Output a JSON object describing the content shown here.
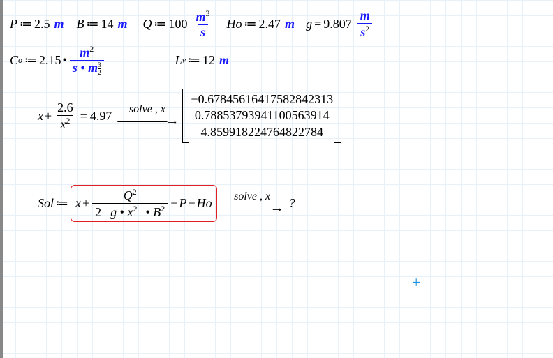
{
  "line1": {
    "P_var": "P",
    "P_val": "2.5",
    "P_unit": "m",
    "B_var": "B",
    "B_val": "14",
    "B_unit": "m",
    "Q_var": "Q",
    "Q_val": "100",
    "Q_num": "m",
    "Q_num_sup": "3",
    "Q_den": "s",
    "Ho_var": "Ho",
    "Ho_val": "2.47",
    "Ho_unit": "m",
    "g_var": "g",
    "g_val": "9.807",
    "g_num": "m",
    "g_den": "s",
    "g_den_sup": "2"
  },
  "line2": {
    "Co_var": "C",
    "Co_sub": "o",
    "Co_val": "2.15",
    "Co_num": "m",
    "Co_num_sup": "2",
    "Co_den1": "s",
    "Co_mul": "•",
    "Co_den2": "m",
    "Co_den2_sup_num": "3",
    "Co_den2_sup_den": "2",
    "Lv_var": "L",
    "Lv_sub": "v",
    "Lv_val": "12",
    "Lv_unit": "m"
  },
  "line3": {
    "x": "x",
    "plus": "+",
    "frac_num": "2.6",
    "frac_den_x": "x",
    "frac_den_sup": "2",
    "rhs": "4.97",
    "solve_label": "solve , x",
    "sol0": "−0.67845616417582842313",
    "sol1": "0.78853793941100563914",
    "sol2": "4.859918224764822784"
  },
  "line4": {
    "Sol": "Sol",
    "x": "x",
    "plus": "+",
    "Q": "Q",
    "Q_sup": "2",
    "two": "2",
    "g": "g",
    "mul": "•",
    "x2": "x",
    "x2_sup": "2",
    "B": "B",
    "B_sup": "2",
    "minus": "−",
    "P": "P",
    "Ho": "Ho",
    "solve_label": "solve , x",
    "result": "?"
  },
  "ops": {
    "assign": "≔",
    "equals": "=",
    "bold_eq": "=",
    "dot": "•"
  }
}
